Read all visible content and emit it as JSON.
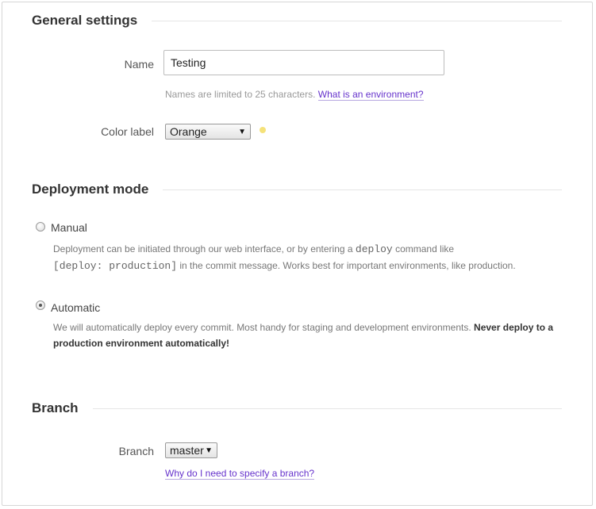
{
  "general": {
    "title": "General settings",
    "name_label": "Name",
    "name_value": "Testing",
    "name_hint": "Names are limited to 25 characters.",
    "name_hint_link": "What is an environment?",
    "color_label": "Color label",
    "color_value": "Orange",
    "color_dot": "#f5e27a"
  },
  "deployment": {
    "title": "Deployment mode",
    "manual": {
      "label": "Manual",
      "checked": false,
      "desc_part1": "Deployment can be initiated through our web interface, or by entering a",
      "desc_code1": "deploy",
      "desc_part2": "command like",
      "desc_code2": "[deploy: production]",
      "desc_part3": "in the commit message. Works best for important environments, like production."
    },
    "automatic": {
      "label": "Automatic",
      "checked": true,
      "desc_part1": "We will automatically deploy every commit. Most handy for staging and development environments.",
      "desc_strong": "Never deploy to a production environment automatically!"
    }
  },
  "branch": {
    "title": "Branch",
    "label": "Branch",
    "value": "master",
    "help_link": "Why do I need to specify a branch?"
  },
  "icons": {
    "select_arrow": "▼"
  }
}
